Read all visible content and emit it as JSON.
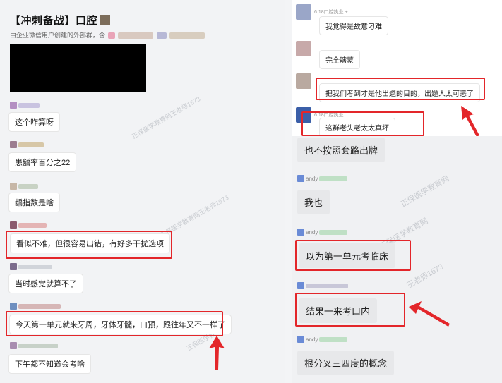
{
  "left": {
    "title": "【冲刺备战】口腔",
    "subtitle": "由企业微信用户创建的外部群，含",
    "messages": [
      {
        "text": "这个咋算呀"
      },
      {
        "text": "患龋率百分之22"
      },
      {
        "text": "龋指数是啥"
      },
      {
        "text": "看似不难，但很容易出错，有好多干扰选项"
      },
      {
        "text": "当时感觉就算不了"
      },
      {
        "text": "今天第一单元就来牙周，牙体牙髓，口预，跟往年又不一样了"
      },
      {
        "text": "下午都不知道会考啥"
      }
    ]
  },
  "right_top": {
    "timestamps": [
      "6.18口腔执业 +",
      "6.18口腔执业"
    ],
    "messages": [
      {
        "text": "我觉得是故意刁难"
      },
      {
        "text": "完全瞎蒙"
      },
      {
        "text": "把我们考到才是他出题的目的，出题人太可恶了"
      },
      {
        "text": "这群老头老太太真坏"
      }
    ]
  },
  "right_bottom": {
    "messages": [
      {
        "text": "也不按照套路出牌"
      },
      {
        "text": "我也"
      },
      {
        "text": "以为第一单元考临床"
      },
      {
        "text": "结果一来考口内"
      },
      {
        "text": "根分叉三四度的概念"
      }
    ],
    "names": [
      "andy",
      "andy",
      "andy"
    ]
  },
  "colors": {
    "highlight": "#e3262a",
    "bubble": "#ffffff",
    "panel": "#f2f3f5"
  }
}
